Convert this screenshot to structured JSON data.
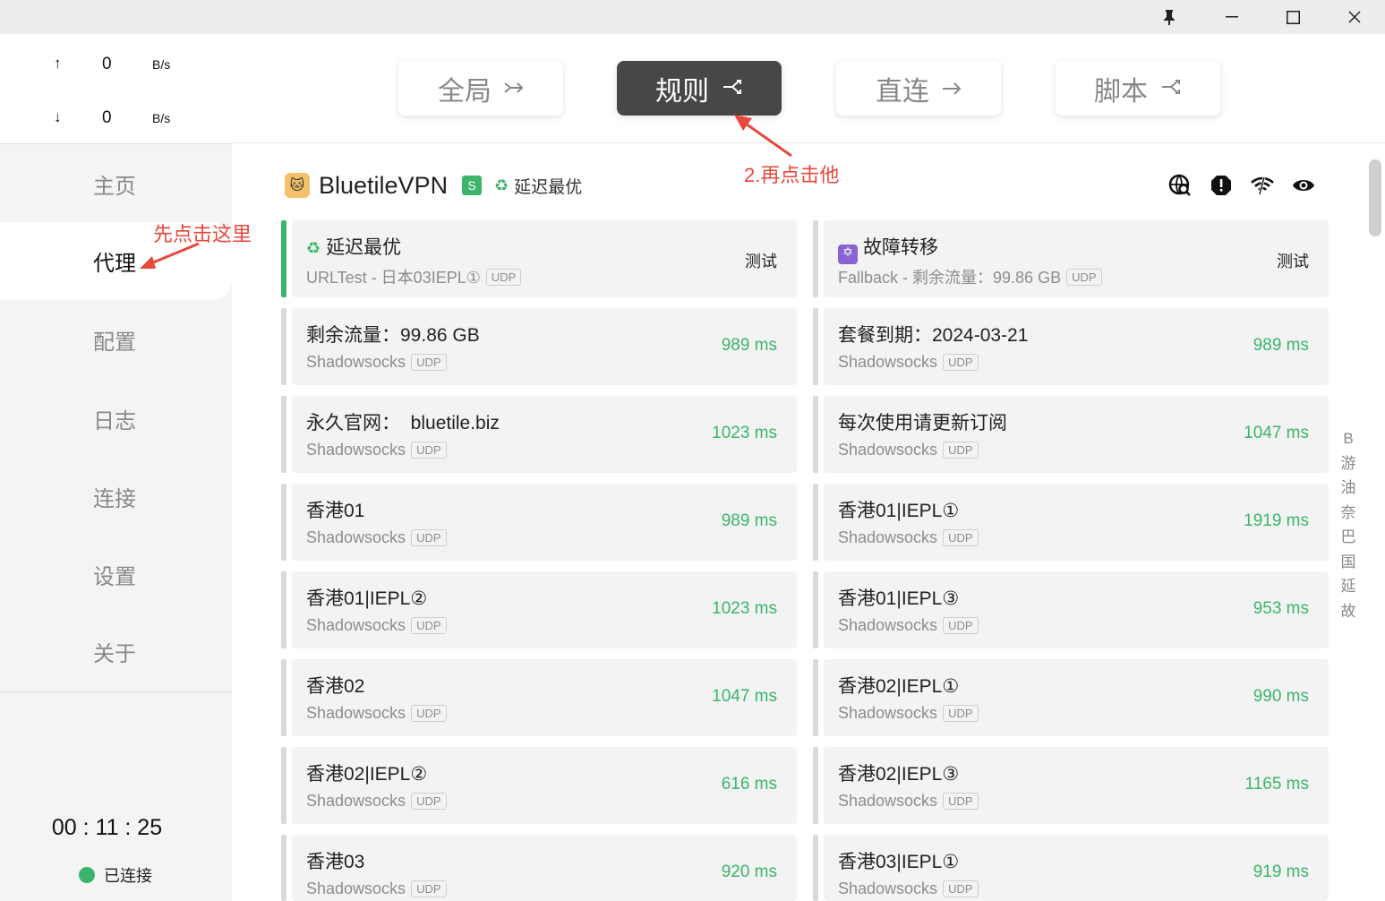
{
  "titlebar": {
    "pin_icon": "pin-icon",
    "minimize_icon": "minimize-icon",
    "maximize_icon": "maximize-icon",
    "close_icon": "close-icon"
  },
  "traffic": {
    "up_arrow": "↑",
    "up_value": "0",
    "up_unit": "B/s",
    "down_arrow": "↓",
    "down_value": "0",
    "down_unit": "B/s"
  },
  "nav": {
    "home": "主页",
    "proxy": "代理",
    "config": "配置",
    "logs": "日志",
    "connections": "连接",
    "settings": "设置",
    "about": "关于"
  },
  "footer": {
    "timer": "00 : 11 : 25",
    "status": "已连接",
    "status_color": "#3bb56b"
  },
  "modes": {
    "global": "全局",
    "rule": "规则",
    "direct": "直连",
    "script": "脚本",
    "active": "rule"
  },
  "group": {
    "name": "BluetileVPN",
    "type_badge": "S",
    "selected": "延迟最优"
  },
  "cards": {
    "c1": {
      "name": "延迟最优",
      "sub": "URLTest - 日本03IEPL①",
      "tag": "UDP",
      "action": "测试"
    },
    "c2": {
      "name": "故障转移",
      "sub": "Fallback - 剩余流量：99.86 GB",
      "tag": "UDP",
      "action": "测试"
    },
    "c3": {
      "name": "剩余流量：99.86 GB",
      "sub": "Shadowsocks",
      "tag": "UDP",
      "delay": "989 ms"
    },
    "c4": {
      "name": "套餐到期：2024-03-21",
      "sub": "Shadowsocks",
      "tag": "UDP",
      "delay": "989 ms"
    },
    "c5": {
      "name": "永久官网：  bluetile.biz",
      "sub": "Shadowsocks",
      "tag": "UDP",
      "delay": "1023 ms"
    },
    "c6": {
      "name": "每次使用请更新订阅",
      "sub": "Shadowsocks",
      "tag": "UDP",
      "delay": "1047 ms"
    },
    "c7": {
      "name": "香港01",
      "sub": "Shadowsocks",
      "tag": "UDP",
      "delay": "989 ms"
    },
    "c8": {
      "name": "香港01|IEPL①",
      "sub": "Shadowsocks",
      "tag": "UDP",
      "delay": "1919 ms"
    },
    "c9": {
      "name": "香港01|IEPL②",
      "sub": "Shadowsocks",
      "tag": "UDP",
      "delay": "1023 ms"
    },
    "c10": {
      "name": "香港01|IEPL③",
      "sub": "Shadowsocks",
      "tag": "UDP",
      "delay": "953 ms"
    },
    "c11": {
      "name": "香港02",
      "sub": "Shadowsocks",
      "tag": "UDP",
      "delay": "1047 ms"
    },
    "c12": {
      "name": "香港02|IEPL①",
      "sub": "Shadowsocks",
      "tag": "UDP",
      "delay": "990 ms"
    },
    "c13": {
      "name": "香港02|IEPL②",
      "sub": "Shadowsocks",
      "tag": "UDP",
      "delay": "616 ms"
    },
    "c14": {
      "name": "香港02|IEPL③",
      "sub": "Shadowsocks",
      "tag": "UDP",
      "delay": "1165 ms"
    },
    "c15": {
      "name": "香港03",
      "sub": "Shadowsocks",
      "tag": "UDP",
      "delay": "920 ms"
    },
    "c16": {
      "name": "香港03|IEPL①",
      "sub": "Shadowsocks",
      "tag": "UDP",
      "delay": "919 ms"
    }
  },
  "alpha_index": [
    "B",
    "游",
    "油",
    "奈",
    "巴",
    "国",
    "延",
    "故"
  ],
  "annotations": {
    "first": "先点击这里",
    "second": "2.再点击他"
  },
  "colors": {
    "accent": "#3bb56b",
    "annotation": "#e8473b",
    "active_mode": "#474747"
  }
}
